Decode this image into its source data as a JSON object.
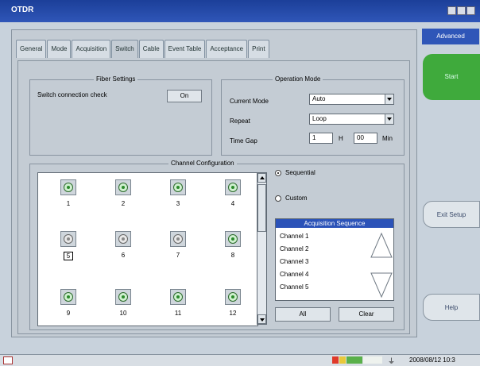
{
  "window": {
    "title": "OTDR"
  },
  "tabs": [
    "General",
    "Mode",
    "Acquisition",
    "Switch",
    "Cable",
    "Event Table",
    "Acceptance",
    "Print"
  ],
  "active_tab": "Switch",
  "fiber_settings": {
    "title": "Fiber Settings",
    "switch_label": "Switch connection check",
    "switch_value": "On"
  },
  "operation_mode": {
    "title": "Operation Mode",
    "current_mode_label": "Current Mode",
    "current_mode_value": "Auto",
    "repeat_label": "Repeat",
    "repeat_value": "Loop",
    "time_gap_label": "Time Gap",
    "time_gap_hours": "1",
    "hours_unit": "H",
    "time_gap_minutes": "00",
    "minutes_unit": "Min"
  },
  "channel_config": {
    "title": "Channel Configuration",
    "channels": [
      {
        "num": "1",
        "state": "on"
      },
      {
        "num": "2",
        "state": "on"
      },
      {
        "num": "3",
        "state": "on"
      },
      {
        "num": "4",
        "state": "on"
      },
      {
        "num": "5",
        "state": "off"
      },
      {
        "num": "6",
        "state": "off"
      },
      {
        "num": "7",
        "state": "off"
      },
      {
        "num": "8",
        "state": "on"
      },
      {
        "num": "9",
        "state": "on"
      },
      {
        "num": "10",
        "state": "on"
      },
      {
        "num": "11",
        "state": "on"
      },
      {
        "num": "12",
        "state": "on"
      }
    ],
    "selected_channel": "5",
    "sequential_label": "Sequential",
    "custom_label": "Custom",
    "selected_mode": "Sequential",
    "sequence_header": "Acquisition Sequence",
    "sequence": [
      "Channel 1",
      "Channel 2",
      "Channel 3",
      "Channel 4",
      "Channel 5"
    ],
    "all_label": "All",
    "clear_label": "Clear"
  },
  "side": {
    "advanced_label": "Advanced",
    "start_label": "Start",
    "exit_setup_label": "Exit Setup",
    "help_label": "Help"
  },
  "status": {
    "datetime": "2008/08/12 10:3"
  },
  "colors": {
    "title_bar": "#2f56b8",
    "start_button": "#3faa3c",
    "panel_bg": "#c4ccd4"
  }
}
